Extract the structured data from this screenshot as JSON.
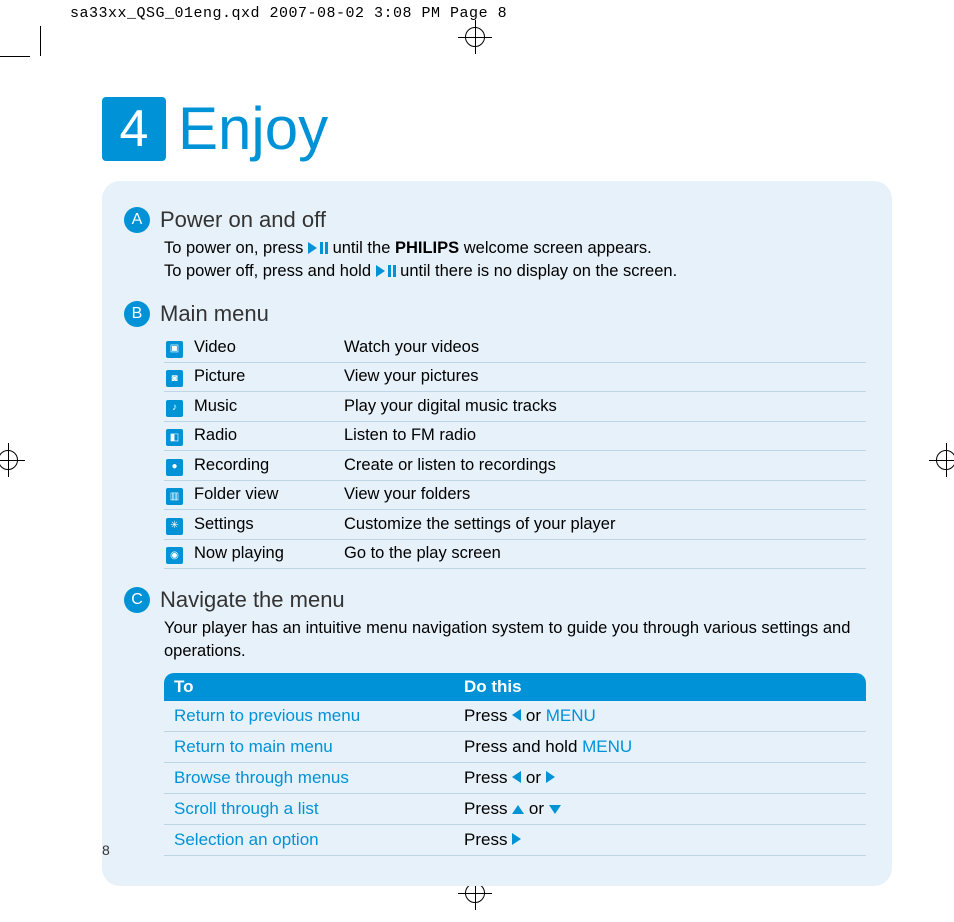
{
  "crop_header": "sa33xx_QSG_01eng.qxd  2007-08-02  3:08 PM  Page 8",
  "chapter_number": "4",
  "chapter_title": "Enjoy",
  "page_number": "8",
  "sectionA": {
    "letter": "A",
    "title": "Power on and off",
    "line1_pre": "To power on, press ",
    "line1_post_pre_bold": " until the ",
    "line1_bold": "PHILIPS",
    "line1_post_bold": " welcome screen appears.",
    "line2_pre": "To power off, press and hold ",
    "line2_post": " until there is no display on the screen."
  },
  "sectionB": {
    "letter": "B",
    "title": "Main menu",
    "items": [
      {
        "glyph": "▣",
        "name": "Video",
        "desc": "Watch your videos"
      },
      {
        "glyph": "◙",
        "name": "Picture",
        "desc": "View your pictures"
      },
      {
        "glyph": "♪",
        "name": "Music",
        "desc": "Play your digital music tracks"
      },
      {
        "glyph": "◧",
        "name": "Radio",
        "desc": "Listen to FM radio"
      },
      {
        "glyph": "●",
        "name": "Recording",
        "desc": "Create or listen to recordings"
      },
      {
        "glyph": "▥",
        "name": "Folder view",
        "desc": "View your folders"
      },
      {
        "glyph": "✳",
        "name": "Settings",
        "desc": "Customize the settings of your player"
      },
      {
        "glyph": "◉",
        "name": "Now playing",
        "desc": "Go to the play screen"
      }
    ]
  },
  "sectionC": {
    "letter": "C",
    "title": "Navigate the menu",
    "intro": "Your player has an intuitive menu navigation system to guide you through various settings and operations.",
    "header_to": "To",
    "header_do": "Do this",
    "rows": {
      "r0_to": "Return to previous menu",
      "r0_press": "Press ",
      "r0_or": " or ",
      "r0_menu": "MENU",
      "r1_to": "Return to main menu",
      "r1_do_pre": "Press and hold ",
      "r1_menu": "MENU",
      "r2_to": "Browse through menus",
      "r2_press": "Press ",
      "r2_or": " or ",
      "r3_to": "Scroll through a list",
      "r3_press": "Press ",
      "r3_or": " or ",
      "r4_to": "Selection an option",
      "r4_press": "Press "
    }
  }
}
